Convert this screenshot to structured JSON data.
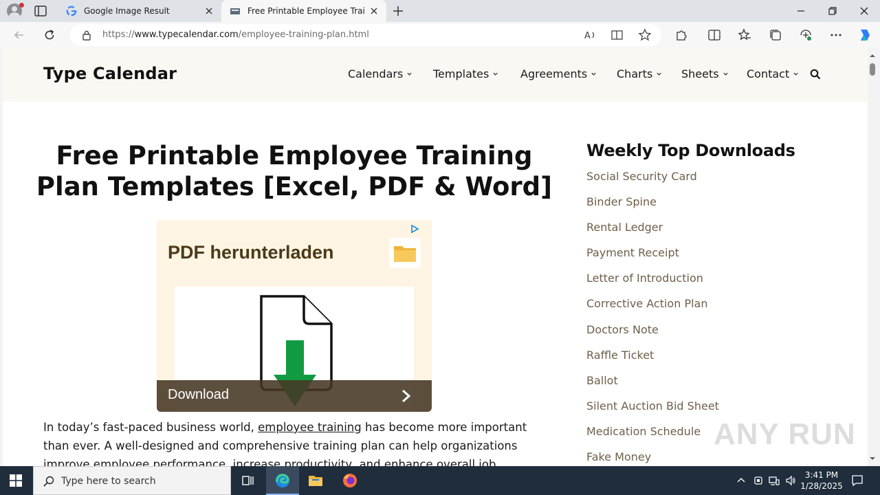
{
  "browser": {
    "tabs": [
      {
        "title": "Google Image Result",
        "favicon": "google-favicon"
      },
      {
        "title": "Free Printable Employee Training",
        "favicon": "typecalendar-favicon",
        "active": true
      }
    ],
    "url_prefix": "https://",
    "url_host": "www.typecalendar.com",
    "url_path": "/employee-training-plan.html"
  },
  "site": {
    "logo": "Type Calendar",
    "nav": [
      "Calendars",
      "Templates",
      "Agreements",
      "Charts",
      "Sheets",
      "Contact"
    ]
  },
  "article": {
    "title": "Free Printable Employee Training Plan Templates [Excel, PDF & Word]",
    "intro_before_link": "In today’s fast-paced business world, ",
    "intro_link": "employee training",
    "intro_after_link": " has become more important than ever. A well-designed and comprehensive training plan can help organizations improve employee performance, increase productivity, and enhance overall job satisfaction."
  },
  "ad": {
    "headline": "PDF herunterladen",
    "cta": "Download"
  },
  "sidebar": {
    "title": "Weekly Top Downloads",
    "items": [
      "Social Security Card",
      "Binder Spine",
      "Rental Ledger",
      "Payment Receipt",
      "Letter of Introduction",
      "Corrective Action Plan",
      "Doctors Note",
      "Raffle Ticket",
      "Ballot",
      "Silent Auction Bid Sheet",
      "Medication Schedule",
      "Fake Money"
    ]
  },
  "watermark": "ANY RUN",
  "taskbar": {
    "search_placeholder": "Type here to search",
    "time": "3:41 PM",
    "date": "1/28/2025"
  },
  "colors": {
    "accent": "#0f6cbd",
    "sidebar_link": "#6e5f49",
    "header_bg": "#faf8f2",
    "ad_bg": "#fdf4e4",
    "taskbar_bg": "#1f2d3d"
  }
}
